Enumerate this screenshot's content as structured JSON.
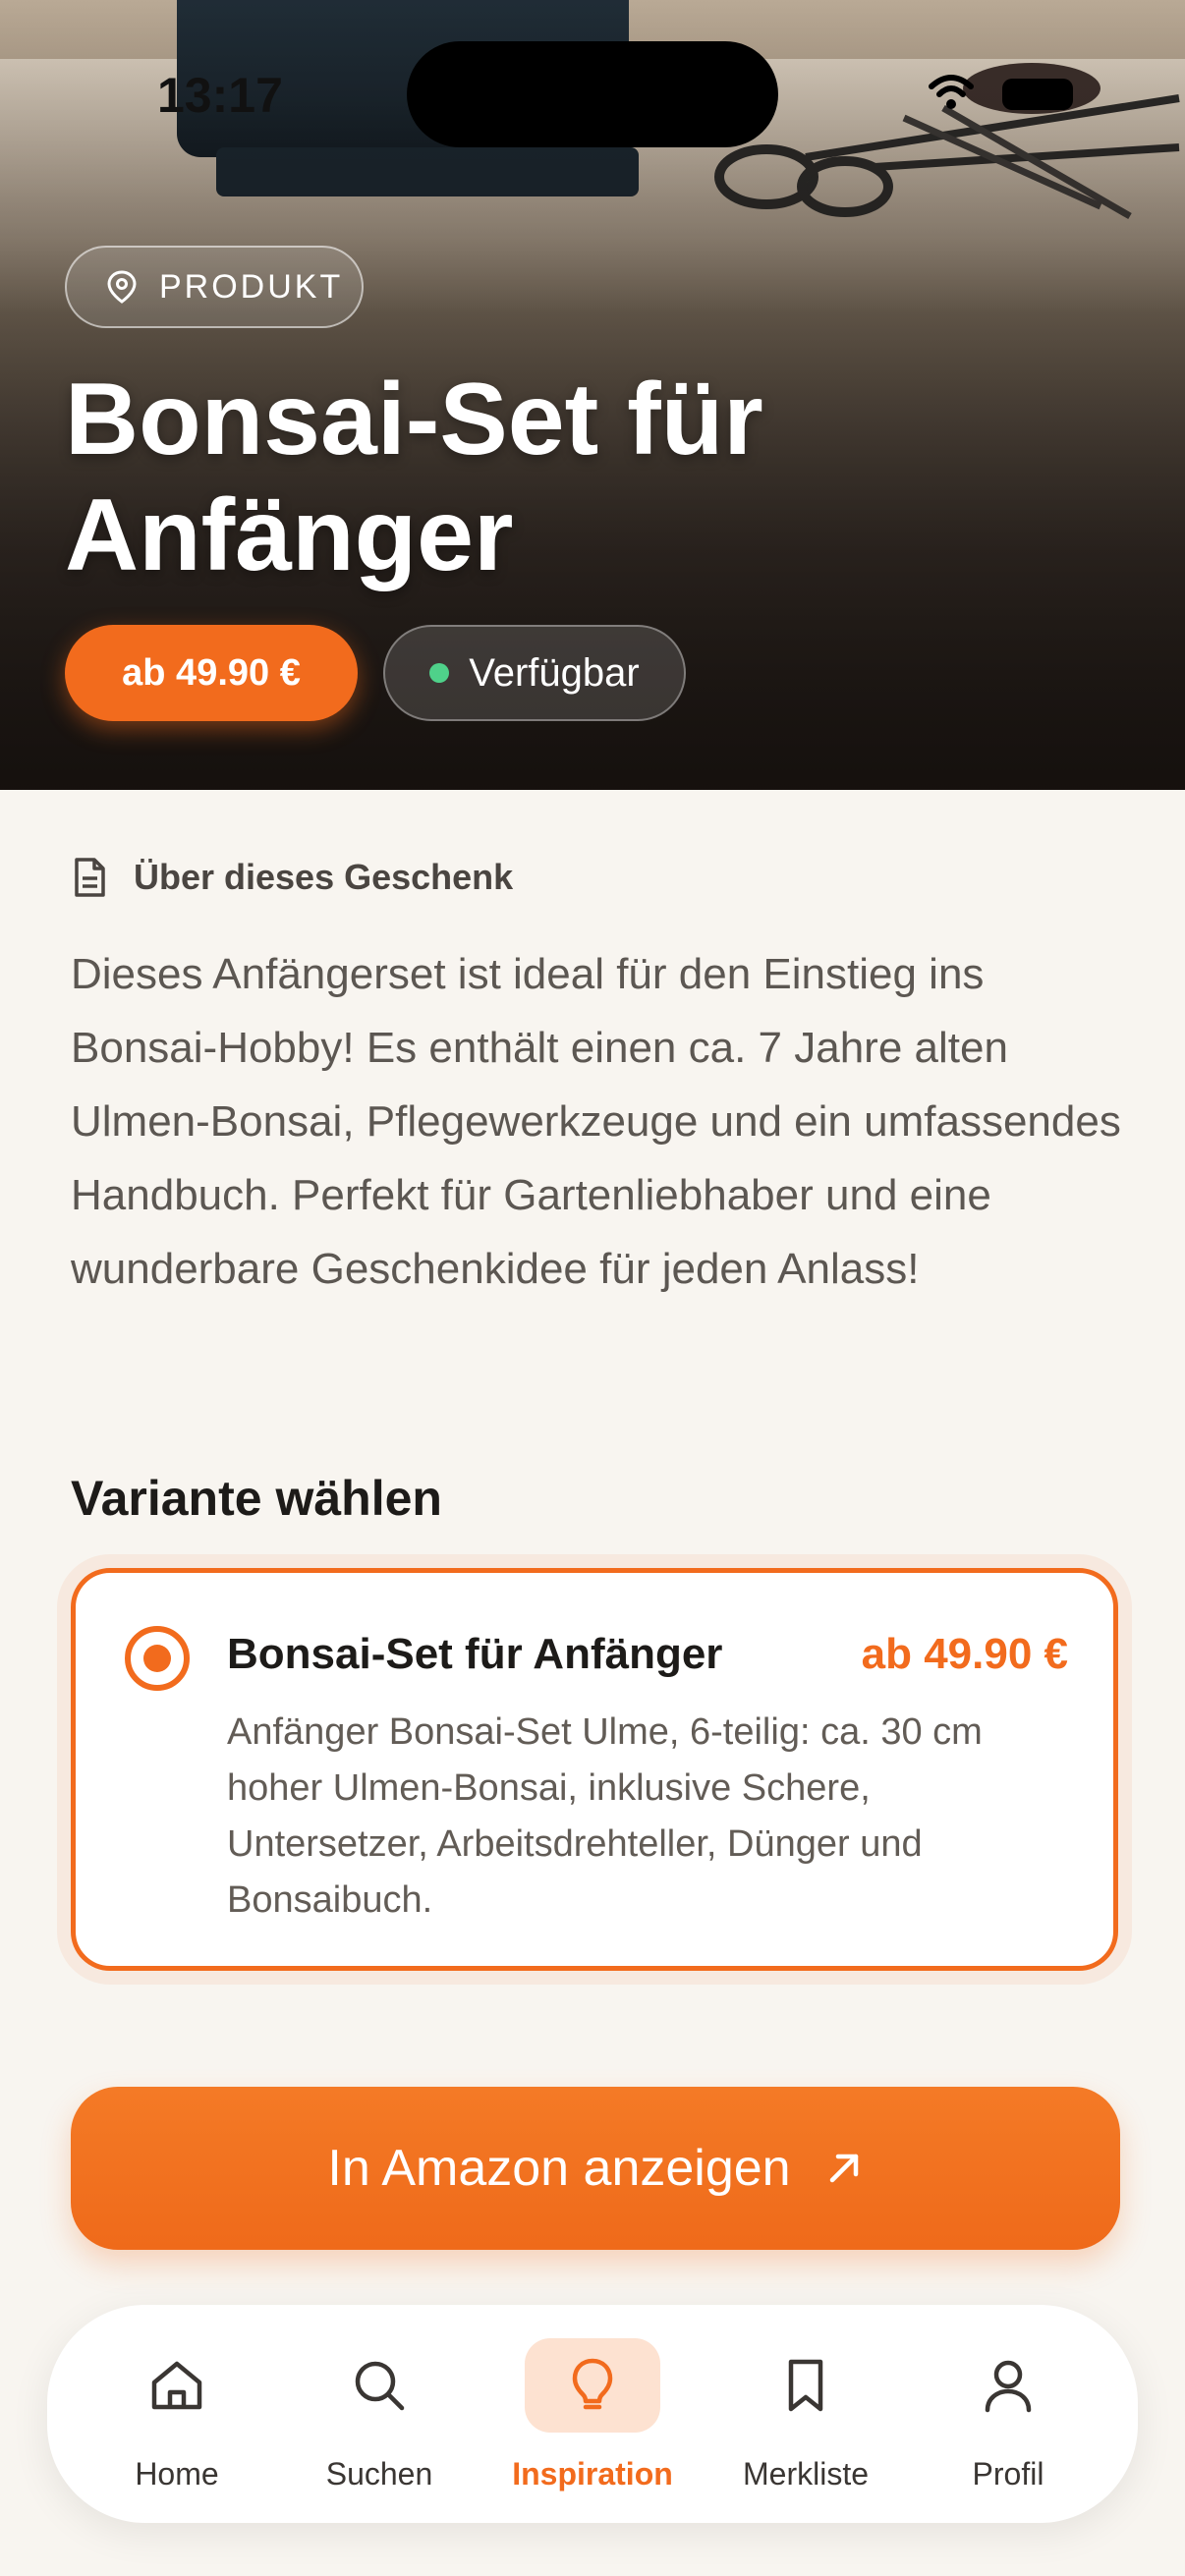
{
  "status_bar": {
    "time": "13:17"
  },
  "hero": {
    "tag_label": "PRODUKT",
    "title": "Bonsai-Set für Anfänger",
    "price": "ab 49.90 €",
    "availability": "Verfügbar"
  },
  "about": {
    "heading": "Über dieses Geschenk",
    "description": "Dieses Anfängerset ist ideal für den Einstieg ins Bonsai-Hobby! Es enthält einen ca. 7 Jahre alten Ulmen-Bonsai, Pflegewerkzeuge und ein umfassendes Handbuch. Perfekt für Gartenliebhaber und eine wunderbare Geschenkidee für jeden Anlass!"
  },
  "variants": {
    "heading": "Variante wählen",
    "items": [
      {
        "name": "Bonsai-Set für Anfänger",
        "price": "ab 49.90 €",
        "description": "Anfänger Bonsai-Set Ulme, 6-teilig: ca. 30 cm hoher Ulmen-Bonsai, inklusive Schere, Untersetzer, Arbeitsdrehteller, Dünger und Bonsaibuch.",
        "selected": true
      }
    ]
  },
  "cta": {
    "label": "In Amazon anzeigen"
  },
  "tabbar": {
    "items": [
      {
        "label": "Home",
        "icon": "home-icon"
      },
      {
        "label": "Suchen",
        "icon": "search-icon"
      },
      {
        "label": "Inspiration",
        "icon": "lightbulb-icon",
        "active": true
      },
      {
        "label": "Merkliste",
        "icon": "bookmark-icon"
      },
      {
        "label": "Profil",
        "icon": "profile-icon"
      }
    ]
  },
  "colors": {
    "accent": "#f26b1d",
    "background": "#f8f5f0",
    "available_dot": "#4fd18a"
  }
}
